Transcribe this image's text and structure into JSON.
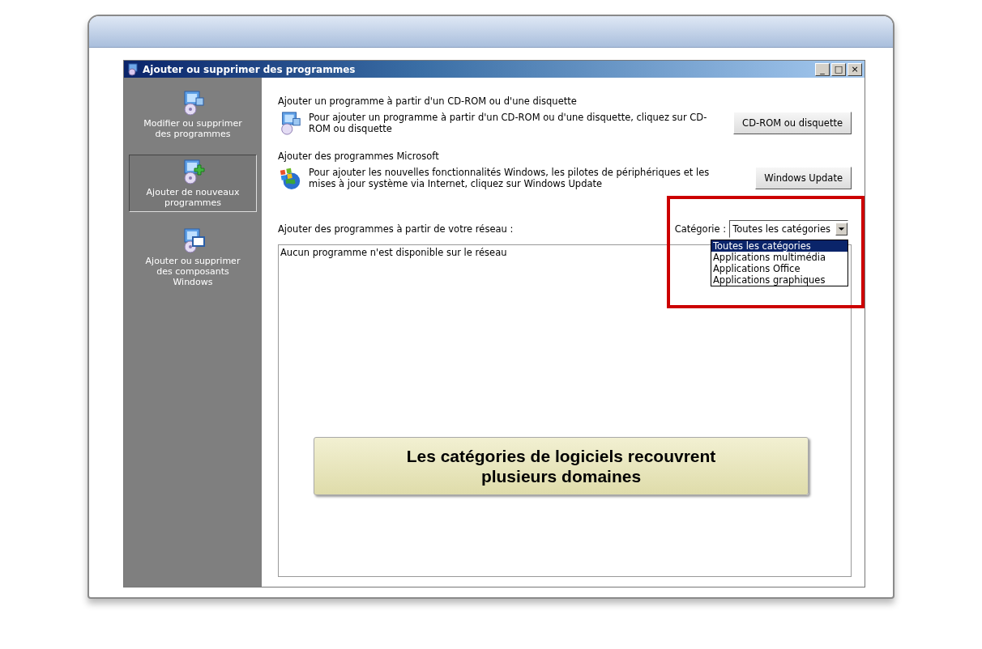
{
  "window": {
    "title": "Ajouter ou supprimer des programmes",
    "controls": [
      "_",
      "□",
      "×"
    ]
  },
  "sidebar": {
    "items": [
      {
        "label": "Modifier ou supprimer des programmes",
        "selected": false
      },
      {
        "label": "Ajouter de nouveaux programmes",
        "selected": true
      },
      {
        "label": "Ajouter ou supprimer des composants Windows",
        "selected": false
      }
    ]
  },
  "sections": [
    {
      "heading": "Ajouter un programme à partir d'un CD-ROM ou d'une disquette",
      "text": "Pour ajouter un programme à partir d'un CD-ROM ou d'une disquette, cliquez sur CD-ROM ou disquette",
      "button": "CD-ROM ou disquette"
    },
    {
      "heading": "Ajouter des programmes Microsoft",
      "text": "Pour ajouter les nouvelles fonctionnalités Windows, les pilotes de périphériques et les mises à jour système via Internet, cliquez sur Windows Update",
      "button": "Windows Update"
    }
  ],
  "network": {
    "heading": "Ajouter des programmes à partir de votre réseau  :",
    "category_label": "Catégorie :",
    "category_value": "Toutes les catégories",
    "dropdown_options": [
      {
        "label": "Toutes les catégories",
        "selected": true
      },
      {
        "label": "Applications multimédia",
        "selected": false
      },
      {
        "label": "Applications Office",
        "selected": false
      },
      {
        "label": "Applications graphiques",
        "selected": false
      }
    ],
    "empty_message": "Aucun programme n'est disponible sur le réseau"
  },
  "callout": "Les catégories de logiciels recouvrent plusieurs domaines"
}
